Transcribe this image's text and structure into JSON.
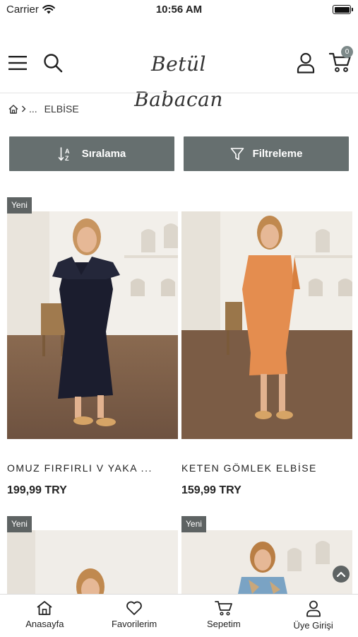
{
  "status": {
    "carrier": "Carrier",
    "time": "10:56 AM"
  },
  "header": {
    "logo_text": "Betül Babacan",
    "cart_count": "0"
  },
  "breadcrumb": {
    "ellipsis": "...",
    "current": "ELBİSE"
  },
  "actions": {
    "sort_label": "Sıralama",
    "filter_label": "Filtreleme"
  },
  "products": [
    {
      "tag": "Yeni",
      "name": "OMUZ FIRFIRLI V YAKA ...",
      "price": "199,99 TRY"
    },
    {
      "tag": "",
      "name": "KETEN GÖMLEK ELBİSE",
      "price": "159,99 TRY"
    },
    {
      "tag": "Yeni",
      "name": "",
      "price": ""
    },
    {
      "tag": "Yeni",
      "name": "",
      "price": ""
    }
  ],
  "tabbar": {
    "home": "Anasayfa",
    "favorites": "Favorilerim",
    "cart": "Sepetim",
    "login": "Üye Girişi"
  },
  "colors": {
    "button_bg": "#666f6f",
    "tag_bg": "#5e6363"
  }
}
